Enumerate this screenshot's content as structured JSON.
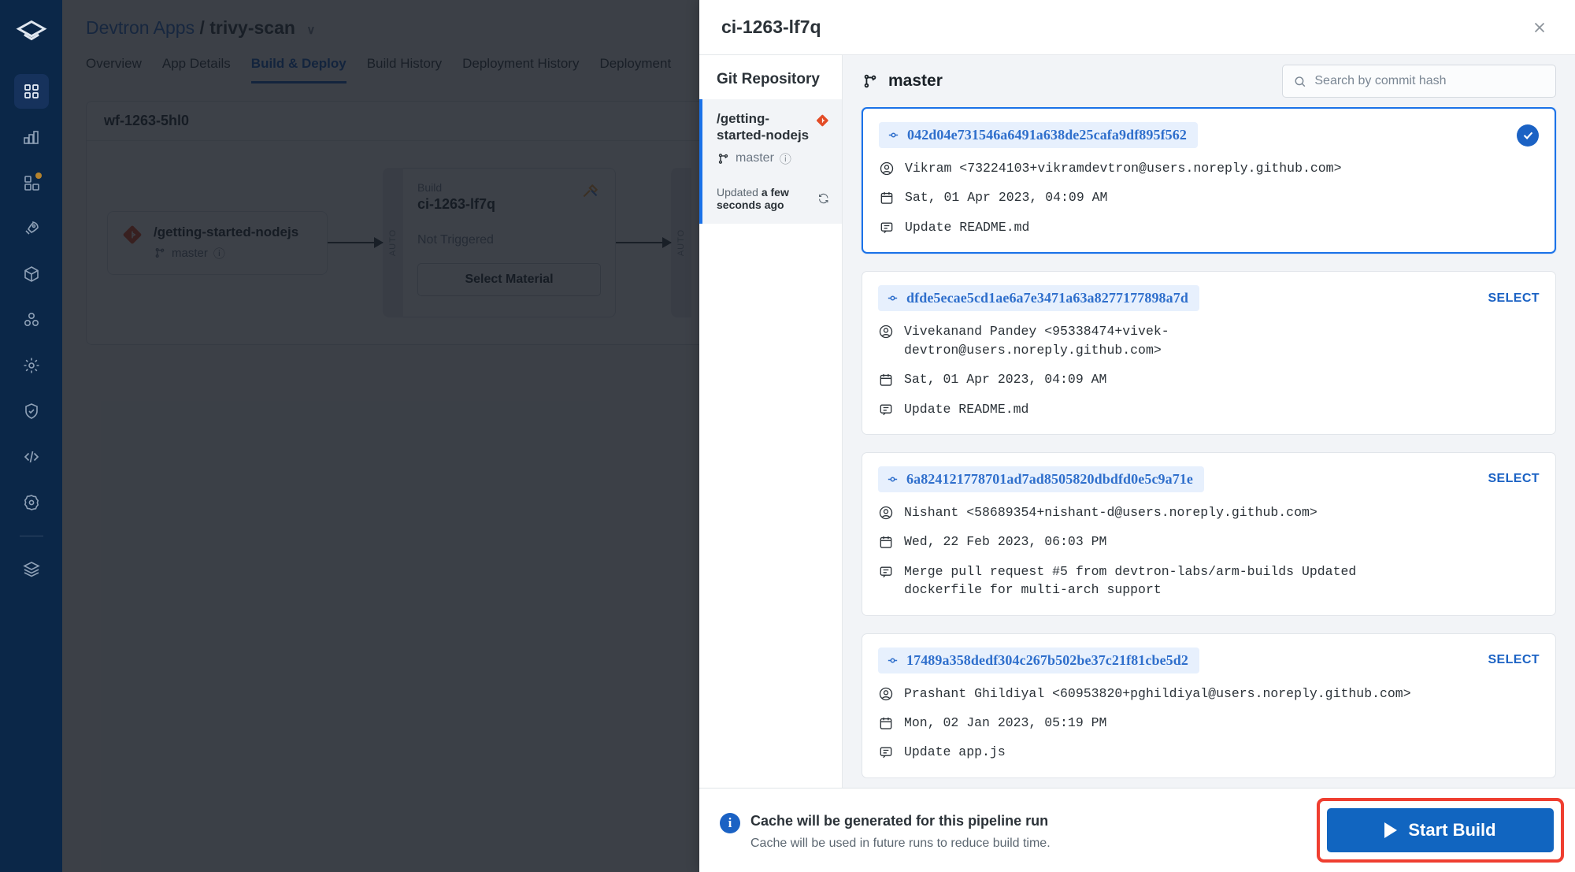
{
  "nav": {
    "logo": "devtron-logo",
    "items": [
      {
        "name": "applications",
        "icon": "grid-icon",
        "active": true,
        "badge": false
      },
      {
        "name": "chart-store",
        "icon": "chart-stack-icon",
        "active": false,
        "badge": false
      },
      {
        "name": "jobs",
        "icon": "jobs-icon",
        "active": false,
        "badge": true
      },
      {
        "name": "deployments",
        "icon": "rocket-icon",
        "active": false,
        "badge": false
      },
      {
        "name": "resource-browser",
        "icon": "cube-icon",
        "active": false,
        "badge": false
      },
      {
        "name": "clusters",
        "icon": "clusters-icon",
        "active": false,
        "badge": false
      },
      {
        "name": "global-configurations",
        "icon": "gear-icon",
        "active": false,
        "badge": false
      },
      {
        "name": "security",
        "icon": "shield-check-icon",
        "active": false,
        "badge": false
      },
      {
        "name": "code",
        "icon": "code-icon",
        "active": false,
        "badge": false
      },
      {
        "name": "settings",
        "icon": "settings-gear-icon",
        "active": false,
        "badge": false
      },
      {
        "name": "stack-manager",
        "icon": "layers-icon",
        "active": false,
        "badge": false
      }
    ]
  },
  "background": {
    "breadcrumb": {
      "root": "Devtron Apps",
      "separator": "/",
      "current": "trivy-scan",
      "chevron": "∨"
    },
    "tabs": [
      {
        "label": "Overview",
        "active": false
      },
      {
        "label": "App Details",
        "active": false
      },
      {
        "label": "Build & Deploy",
        "active": true
      },
      {
        "label": "Build History",
        "active": false
      },
      {
        "label": "Deployment History",
        "active": false
      },
      {
        "label": "Deployment",
        "active": false
      }
    ],
    "workflow": {
      "title": "wf-1263-5hl0",
      "git_node": {
        "repo": "/getting-started-nodejs",
        "branch": "master",
        "icon": "git-diamond-icon"
      },
      "auto_label": "AUTO",
      "build_node": {
        "kind_label": "Build",
        "name": "ci-1263-lf7q",
        "status": "Not Triggered",
        "button": "Select Material",
        "icon": "build-tools-icon"
      }
    }
  },
  "modal": {
    "title": "ci-1263-lf7q",
    "close_icon": "close-icon",
    "repo_pane": {
      "heading": "Git Repository",
      "item": {
        "name": "/getting-started-nodejs",
        "branch": "master",
        "branch_icon": "git-branch-icon",
        "info_icon": "info-circle-icon",
        "provider_icon": "git-diamond-icon",
        "updated_label": "Updated",
        "updated_value": "a few seconds ago",
        "refresh_icon": "refresh-icon"
      }
    },
    "commit_pane": {
      "branch": "master",
      "branch_icon": "git-branch-icon",
      "search": {
        "placeholder": "Search by commit hash",
        "value": "",
        "icon": "search-icon"
      },
      "select_label": "SELECT",
      "commits": [
        {
          "hash": "042d04e731546a6491a638de25cafa9df895f562",
          "author": "Vikram <73224103+vikramdevtron@users.noreply.github.com>",
          "date": "Sat, 01 Apr 2023, 04:09 AM",
          "message": "Update README.md",
          "selected": true
        },
        {
          "hash": "dfde5ecae5cd1ae6a7e3471a63a8277177898a7d",
          "author": "Vivekanand Pandey <95338474+vivek-devtron@users.noreply.github.com>",
          "date": "Sat, 01 Apr 2023, 04:09 AM",
          "message": "Update README.md",
          "selected": false
        },
        {
          "hash": "6a824121778701ad7ad8505820dbdfd0e5c9a71e",
          "author": "Nishant <58689354+nishant-d@users.noreply.github.com>",
          "date": "Wed, 22 Feb 2023, 06:03 PM",
          "message": "Merge pull request #5 from devtron-labs/arm-builds Updated dockerfile for multi-arch support",
          "selected": false
        },
        {
          "hash": "17489a358dedf304c267b502be37c21f81cbe5d2",
          "author": "Prashant Ghildiyal <60953820+pghildiyal@users.noreply.github.com>",
          "date": "Mon, 02 Jan 2023, 05:19 PM",
          "message": "Update app.js",
          "selected": false
        }
      ]
    },
    "footer": {
      "info_icon": "info-circle-icon",
      "cache_title": "Cache will be generated for this pipeline run",
      "cache_subtitle": "Cache will be used in future runs to reduce build time.",
      "start_button": "Start Build",
      "start_button_icon": "play-icon",
      "highlight_color": "#ef3e30",
      "button_color": "#1165c0"
    }
  }
}
